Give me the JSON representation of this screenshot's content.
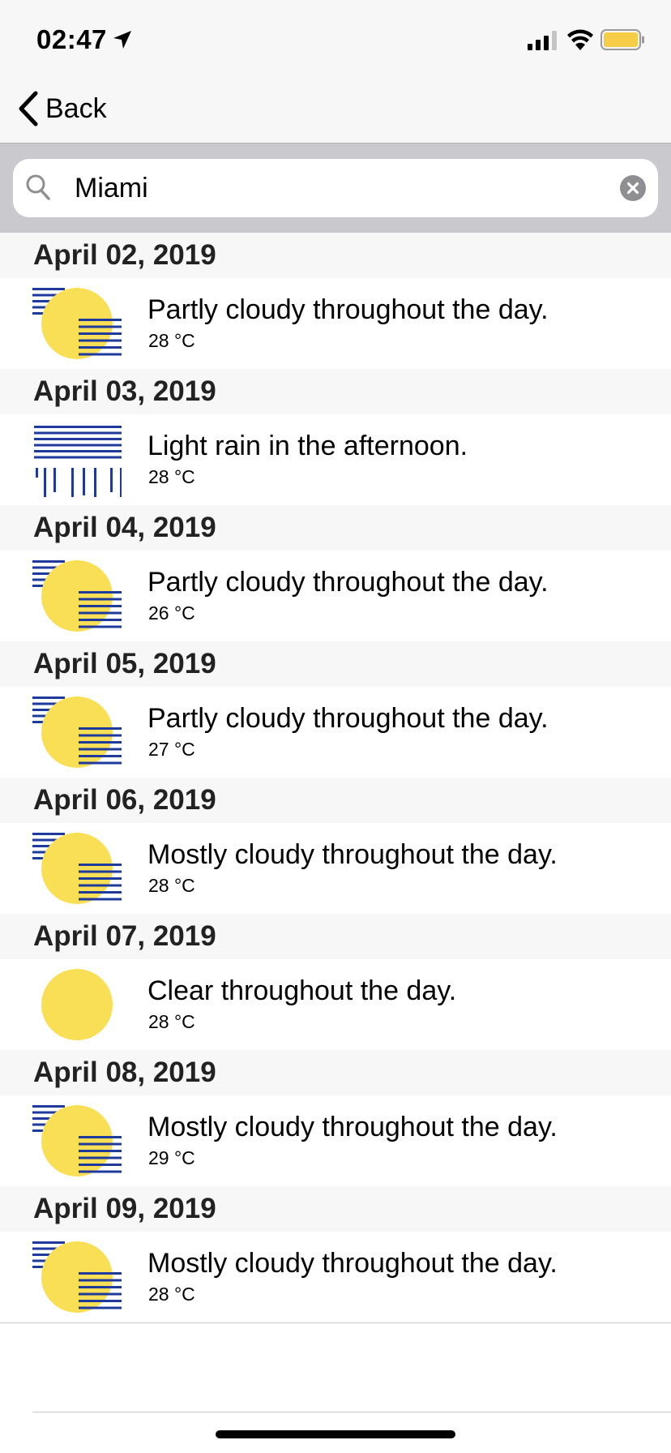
{
  "status_bar": {
    "time": "02:47"
  },
  "nav": {
    "back_label": "Back"
  },
  "search": {
    "value": "Miami"
  },
  "colors": {
    "sun": "#f8df55",
    "stripe": "#1d3a9c",
    "battery": "#f6cd46"
  },
  "forecast": [
    {
      "date": "April 02, 2019",
      "icon": "partly-cloudy-icon",
      "summary": "Partly cloudy throughout the day.",
      "temp": "28 °C"
    },
    {
      "date": "April 03, 2019",
      "icon": "rain-icon",
      "summary": "Light rain in the afternoon.",
      "temp": "28 °C"
    },
    {
      "date": "April 04, 2019",
      "icon": "partly-cloudy-icon",
      "summary": "Partly cloudy throughout the day.",
      "temp": "26 °C"
    },
    {
      "date": "April 05, 2019",
      "icon": "partly-cloudy-icon",
      "summary": "Partly cloudy throughout the day.",
      "temp": "27 °C"
    },
    {
      "date": "April 06, 2019",
      "icon": "partly-cloudy-icon",
      "summary": "Mostly cloudy throughout the day.",
      "temp": "28 °C"
    },
    {
      "date": "April 07, 2019",
      "icon": "clear-day-icon",
      "summary": "Clear throughout the day.",
      "temp": "28 °C"
    },
    {
      "date": "April 08, 2019",
      "icon": "partly-cloudy-icon",
      "summary": "Mostly cloudy throughout the day.",
      "temp": "29 °C"
    },
    {
      "date": "April 09, 2019",
      "icon": "partly-cloudy-icon",
      "summary": "Mostly cloudy throughout the day.",
      "temp": "28 °C"
    }
  ]
}
